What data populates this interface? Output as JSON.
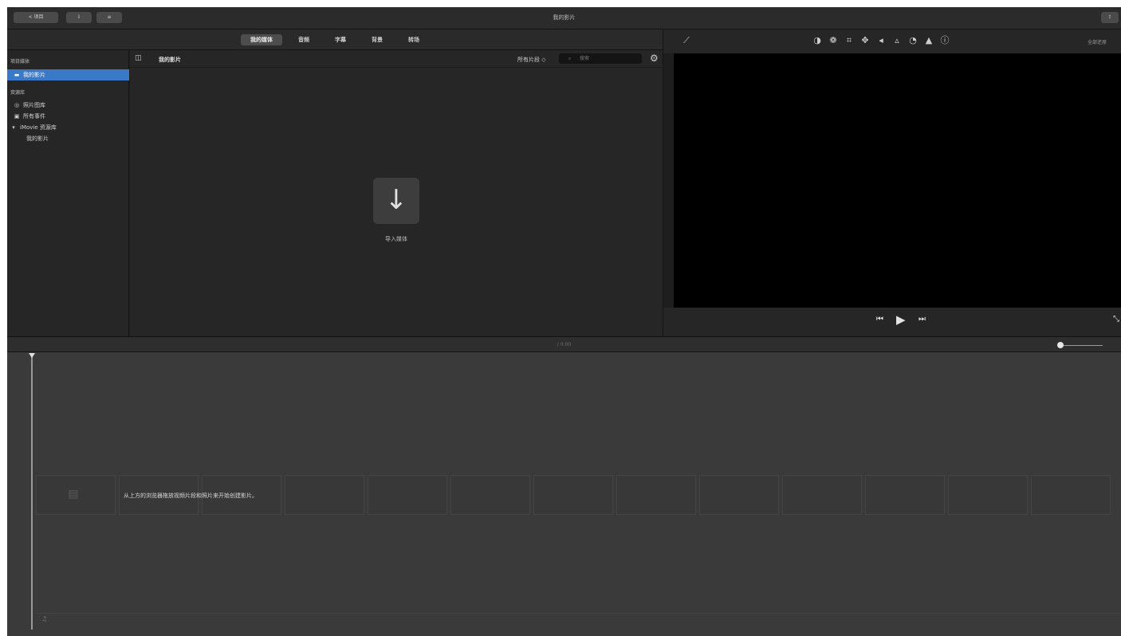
{
  "window": {
    "title": "我的影片"
  },
  "toolbar": {
    "back_label": "< 项目",
    "media_label": "",
    "share_label": "",
    "right_label": ""
  },
  "tabs": [
    {
      "label": "我的媒体",
      "active": true
    },
    {
      "label": "音频",
      "active": false
    },
    {
      "label": "字幕",
      "active": false
    },
    {
      "label": "背景",
      "active": false
    },
    {
      "label": "转场",
      "active": false
    }
  ],
  "sidebar": {
    "section_project": "项目媒体",
    "project_item": "我的影片",
    "section_library": "资源库",
    "items": [
      {
        "icon": "photos-icon",
        "glyph": "◎",
        "label": "照片图库"
      },
      {
        "icon": "events-icon",
        "glyph": "▣",
        "label": "所有事件"
      },
      {
        "icon": "disclosure-icon",
        "glyph": "▾",
        "label": "iMovie 资源库"
      }
    ],
    "sub_item": "我的影片"
  },
  "browser": {
    "title": "我的影片",
    "filter": "所有片段 ◇",
    "search_placeholder": "搜索",
    "import_label": "导入媒体"
  },
  "viewer": {
    "tools": [
      "color-balance-icon",
      "color-correction-icon",
      "crop-icon",
      "stabilization-icon",
      "volume-icon",
      "noise-reduction-icon",
      "speed-icon",
      "clip-filter-icon",
      "info-icon"
    ],
    "reset_label": "全部还原"
  },
  "timeline": {
    "timecode": "/ 0:00",
    "hint": "从上方的浏览器拖放视频片段和照片来开始创建影片。"
  }
}
